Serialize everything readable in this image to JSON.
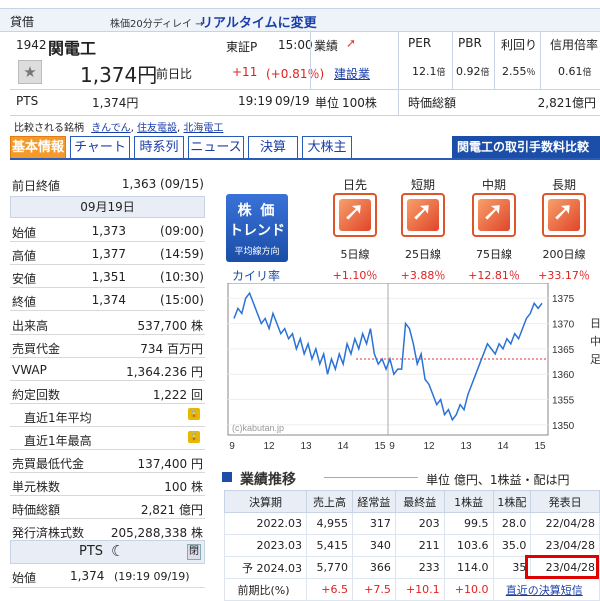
{
  "header": {
    "tag": "貸借",
    "delay_note": "株価20分ディレイ →",
    "realtime_link": "リアルタイムに変更",
    "code": "1942",
    "name": "関電工",
    "market": "東証P",
    "time": "15:00",
    "gyoseki": "業績",
    "price": "1,374円",
    "change_label": "前日比",
    "change": "+11",
    "change_pct": "(+0.81％)",
    "industry": "建設業",
    "pts_label": "PTS",
    "pts_price": "1,374円",
    "pts_time": "19:19",
    "pts_date": "09/19",
    "unit_label": "単位",
    "unit_value": "100株",
    "compare_label": "比較される銘柄",
    "compare": [
      "きんでん",
      "住友電設",
      "北海電工"
    ],
    "metrics": [
      {
        "label": "PER",
        "value": "12.1",
        "unit": "倍"
      },
      {
        "label": "PBR",
        "value": "0.92",
        "unit": "倍"
      },
      {
        "label": "利回り",
        "value": "2.55",
        "unit": "％"
      },
      {
        "label": "信用倍率",
        "value": "0.61",
        "unit": "倍"
      }
    ],
    "market_cap_label": "時価総額",
    "market_cap": "2,821億円"
  },
  "tabs": [
    "基本情報",
    "チャート",
    "時系列",
    "ニュース",
    "決算",
    "大株主"
  ],
  "fee_banner": "関電工の取引手数料比較",
  "prev_close_label": "前日終値",
  "prev_close": "1,363 (09/15)",
  "day_label": "09月19日",
  "ohlc": [
    {
      "label": "始値",
      "value": "1,373",
      "time": "(09:00)"
    },
    {
      "label": "高値",
      "value": "1,377",
      "time": "(14:59)"
    },
    {
      "label": "安値",
      "value": "1,351",
      "time": "(10:30)"
    },
    {
      "label": "終値",
      "value": "1,374",
      "time": "(15:00)"
    }
  ],
  "stats": [
    {
      "label": "出来高",
      "value": "537,700 株"
    },
    {
      "label": "売買代金",
      "value": "734 百万円"
    },
    {
      "label": "VWAP",
      "value": "1,364.236 円"
    },
    {
      "label": "約定回数",
      "value": "1,222 回"
    },
    {
      "label": "直近1年平均",
      "value": ""
    },
    {
      "label": "直近1年最高",
      "value": ""
    },
    {
      "label": "売買最低代金",
      "value": "137,400 円"
    },
    {
      "label": "単元株数",
      "value": "100 株"
    },
    {
      "label": "時価総額",
      "value": "2,821 億円"
    },
    {
      "label": "発行済株式数",
      "value": "205,288,338 株"
    }
  ],
  "pts_box": {
    "title": "PTS",
    "close_btn": "閉",
    "label": "始値",
    "value": "1,374",
    "time": "(19:19  09/19)"
  },
  "trend": {
    "badge_line1": "株 価",
    "badge_line2": "トレンド",
    "badge_sub": "平均線方向",
    "kairi_label": "カイリ率",
    "items": [
      {
        "period": "日先",
        "line": "5日線",
        "kairi": "+1.10％"
      },
      {
        "period": "短期",
        "line": "25日線",
        "kairi": "+3.88％"
      },
      {
        "period": "中期",
        "line": "75日線",
        "kairi": "+12.81％"
      },
      {
        "period": "長期",
        "line": "200日線",
        "kairi": "+33.17％"
      }
    ]
  },
  "chart_data": {
    "type": "line",
    "watermark": "(c)kabutan.jp",
    "xlabels": [
      "9",
      "12",
      "13",
      "14",
      "15",
      "9",
      "12",
      "13",
      "14",
      "15"
    ],
    "ylabels": [
      "1375",
      "1370",
      "1365",
      "1360",
      "1355",
      "1350"
    ],
    "side_labels": [
      "日",
      "中",
      "足"
    ],
    "ylim": [
      1348,
      1378
    ],
    "prev_close": 1363,
    "series": [
      {
        "values": [
          1371,
          1373,
          1372,
          1375,
          1376,
          1374,
          1372,
          1370,
          1371,
          1369,
          1372,
          1370,
          1368,
          1369,
          1367,
          1368,
          1365,
          1367,
          1364,
          1366,
          1363,
          1365,
          1362,
          1364,
          1360,
          1363,
          1361,
          1364,
          1362,
          1366,
          1364,
          1367,
          1365,
          1368,
          1366,
          1369,
          1364,
          1362,
          1363,
          1361,
          1363,
          1360,
          1361,
          1361,
          1370,
          1369,
          1366,
          1362,
          1364,
          1359,
          1358,
          1356,
          1354,
          1355,
          1352,
          1353,
          1351,
          1352,
          1354,
          1353,
          1356,
          1358,
          1360,
          1362,
          1364,
          1366,
          1365,
          1364,
          1366,
          1365,
          1367,
          1366,
          1368,
          1367,
          1369,
          1371,
          1372,
          1374,
          1373,
          1374
        ]
      }
    ]
  },
  "gyoseki": {
    "title": "業績推移",
    "note": "単位 億円、1株益・配は円",
    "columns": [
      "決算期",
      "売上高",
      "経常益",
      "最終益",
      "1株益",
      "1株配",
      "発表日"
    ],
    "rows": [
      [
        "2022.03",
        "4,955",
        "317",
        "203",
        "99.5",
        "28.0",
        "22/04/28"
      ],
      [
        "2023.03",
        "5,415",
        "340",
        "211",
        "103.6",
        "35.0",
        "23/04/28"
      ],
      [
        "予 2024.03",
        "5,770",
        "366",
        "233",
        "114.0",
        "35",
        "23/04/28"
      ]
    ],
    "compare_label": "前期比(%)",
    "compare": [
      "+6.5",
      "+7.5",
      "+10.1",
      "+10.0"
    ],
    "kessan_link": "直近の決算短信"
  }
}
